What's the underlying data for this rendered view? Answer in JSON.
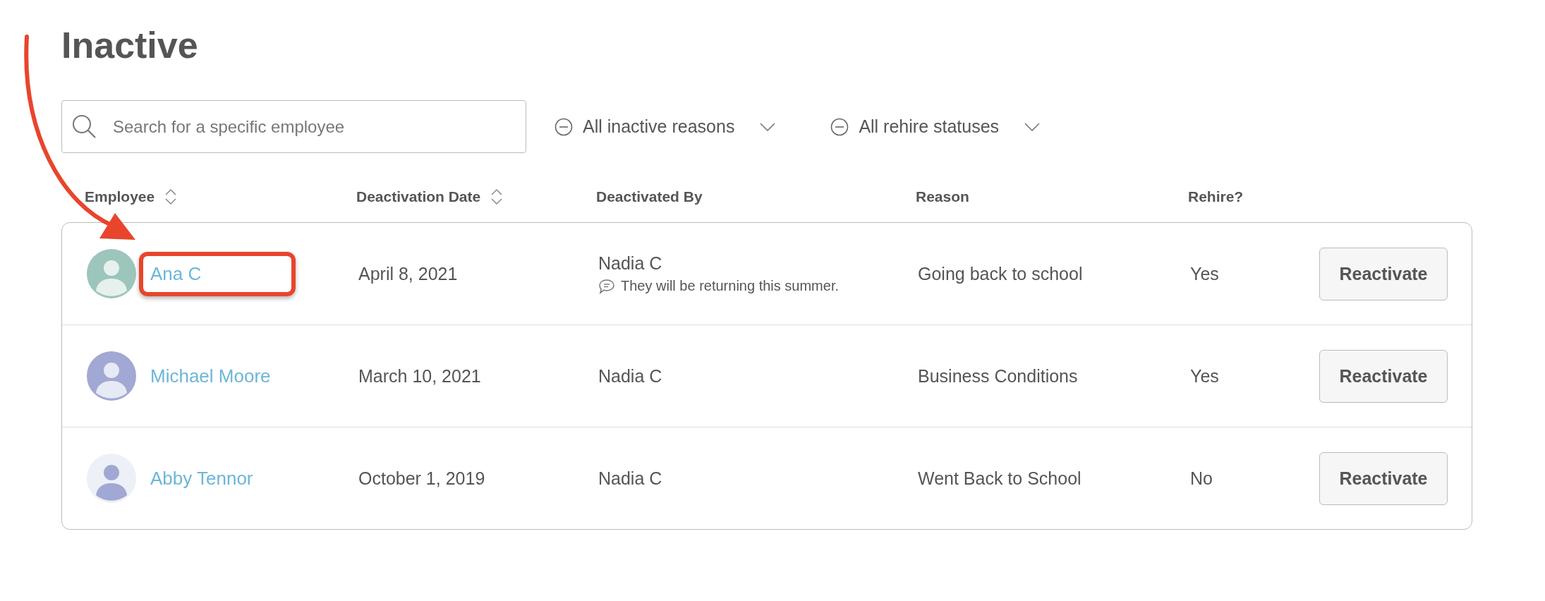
{
  "title": "Inactive",
  "search": {
    "placeholder": "Search for a specific employee"
  },
  "filters": [
    {
      "label": "All inactive reasons"
    },
    {
      "label": "All rehire statuses"
    }
  ],
  "table": {
    "columns": [
      {
        "label": "Employee",
        "sortable": true
      },
      {
        "label": "Deactivation Date",
        "sortable": true
      },
      {
        "label": "Deactivated By",
        "sortable": false
      },
      {
        "label": "Reason",
        "sortable": false
      },
      {
        "label": "Rehire?",
        "sortable": false
      }
    ],
    "rows": [
      {
        "name": "Ana C",
        "highlighted": true,
        "avatar": {
          "color": "#9cc5bc",
          "kind": "filled"
        },
        "date": "April 8, 2021",
        "by": "Nadia C",
        "note": "They will be returning this summer.",
        "reason": "Going back to school",
        "rehire": "Yes",
        "action": "Reactivate"
      },
      {
        "name": "Michael Moore",
        "highlighted": false,
        "avatar": {
          "color": "#a1a8d3",
          "kind": "filled"
        },
        "date": "March 10, 2021",
        "by": "Nadia C",
        "reason": "Business Conditions",
        "rehire": "Yes",
        "action": "Reactivate"
      },
      {
        "name": "Abby Tennor",
        "highlighted": false,
        "avatar": {
          "color": "#eef0f8",
          "kind": "light"
        },
        "date": "October 1, 2019",
        "by": "Nadia C",
        "reason": "Went Back to School",
        "rehire": "No",
        "action": "Reactivate"
      }
    ]
  }
}
